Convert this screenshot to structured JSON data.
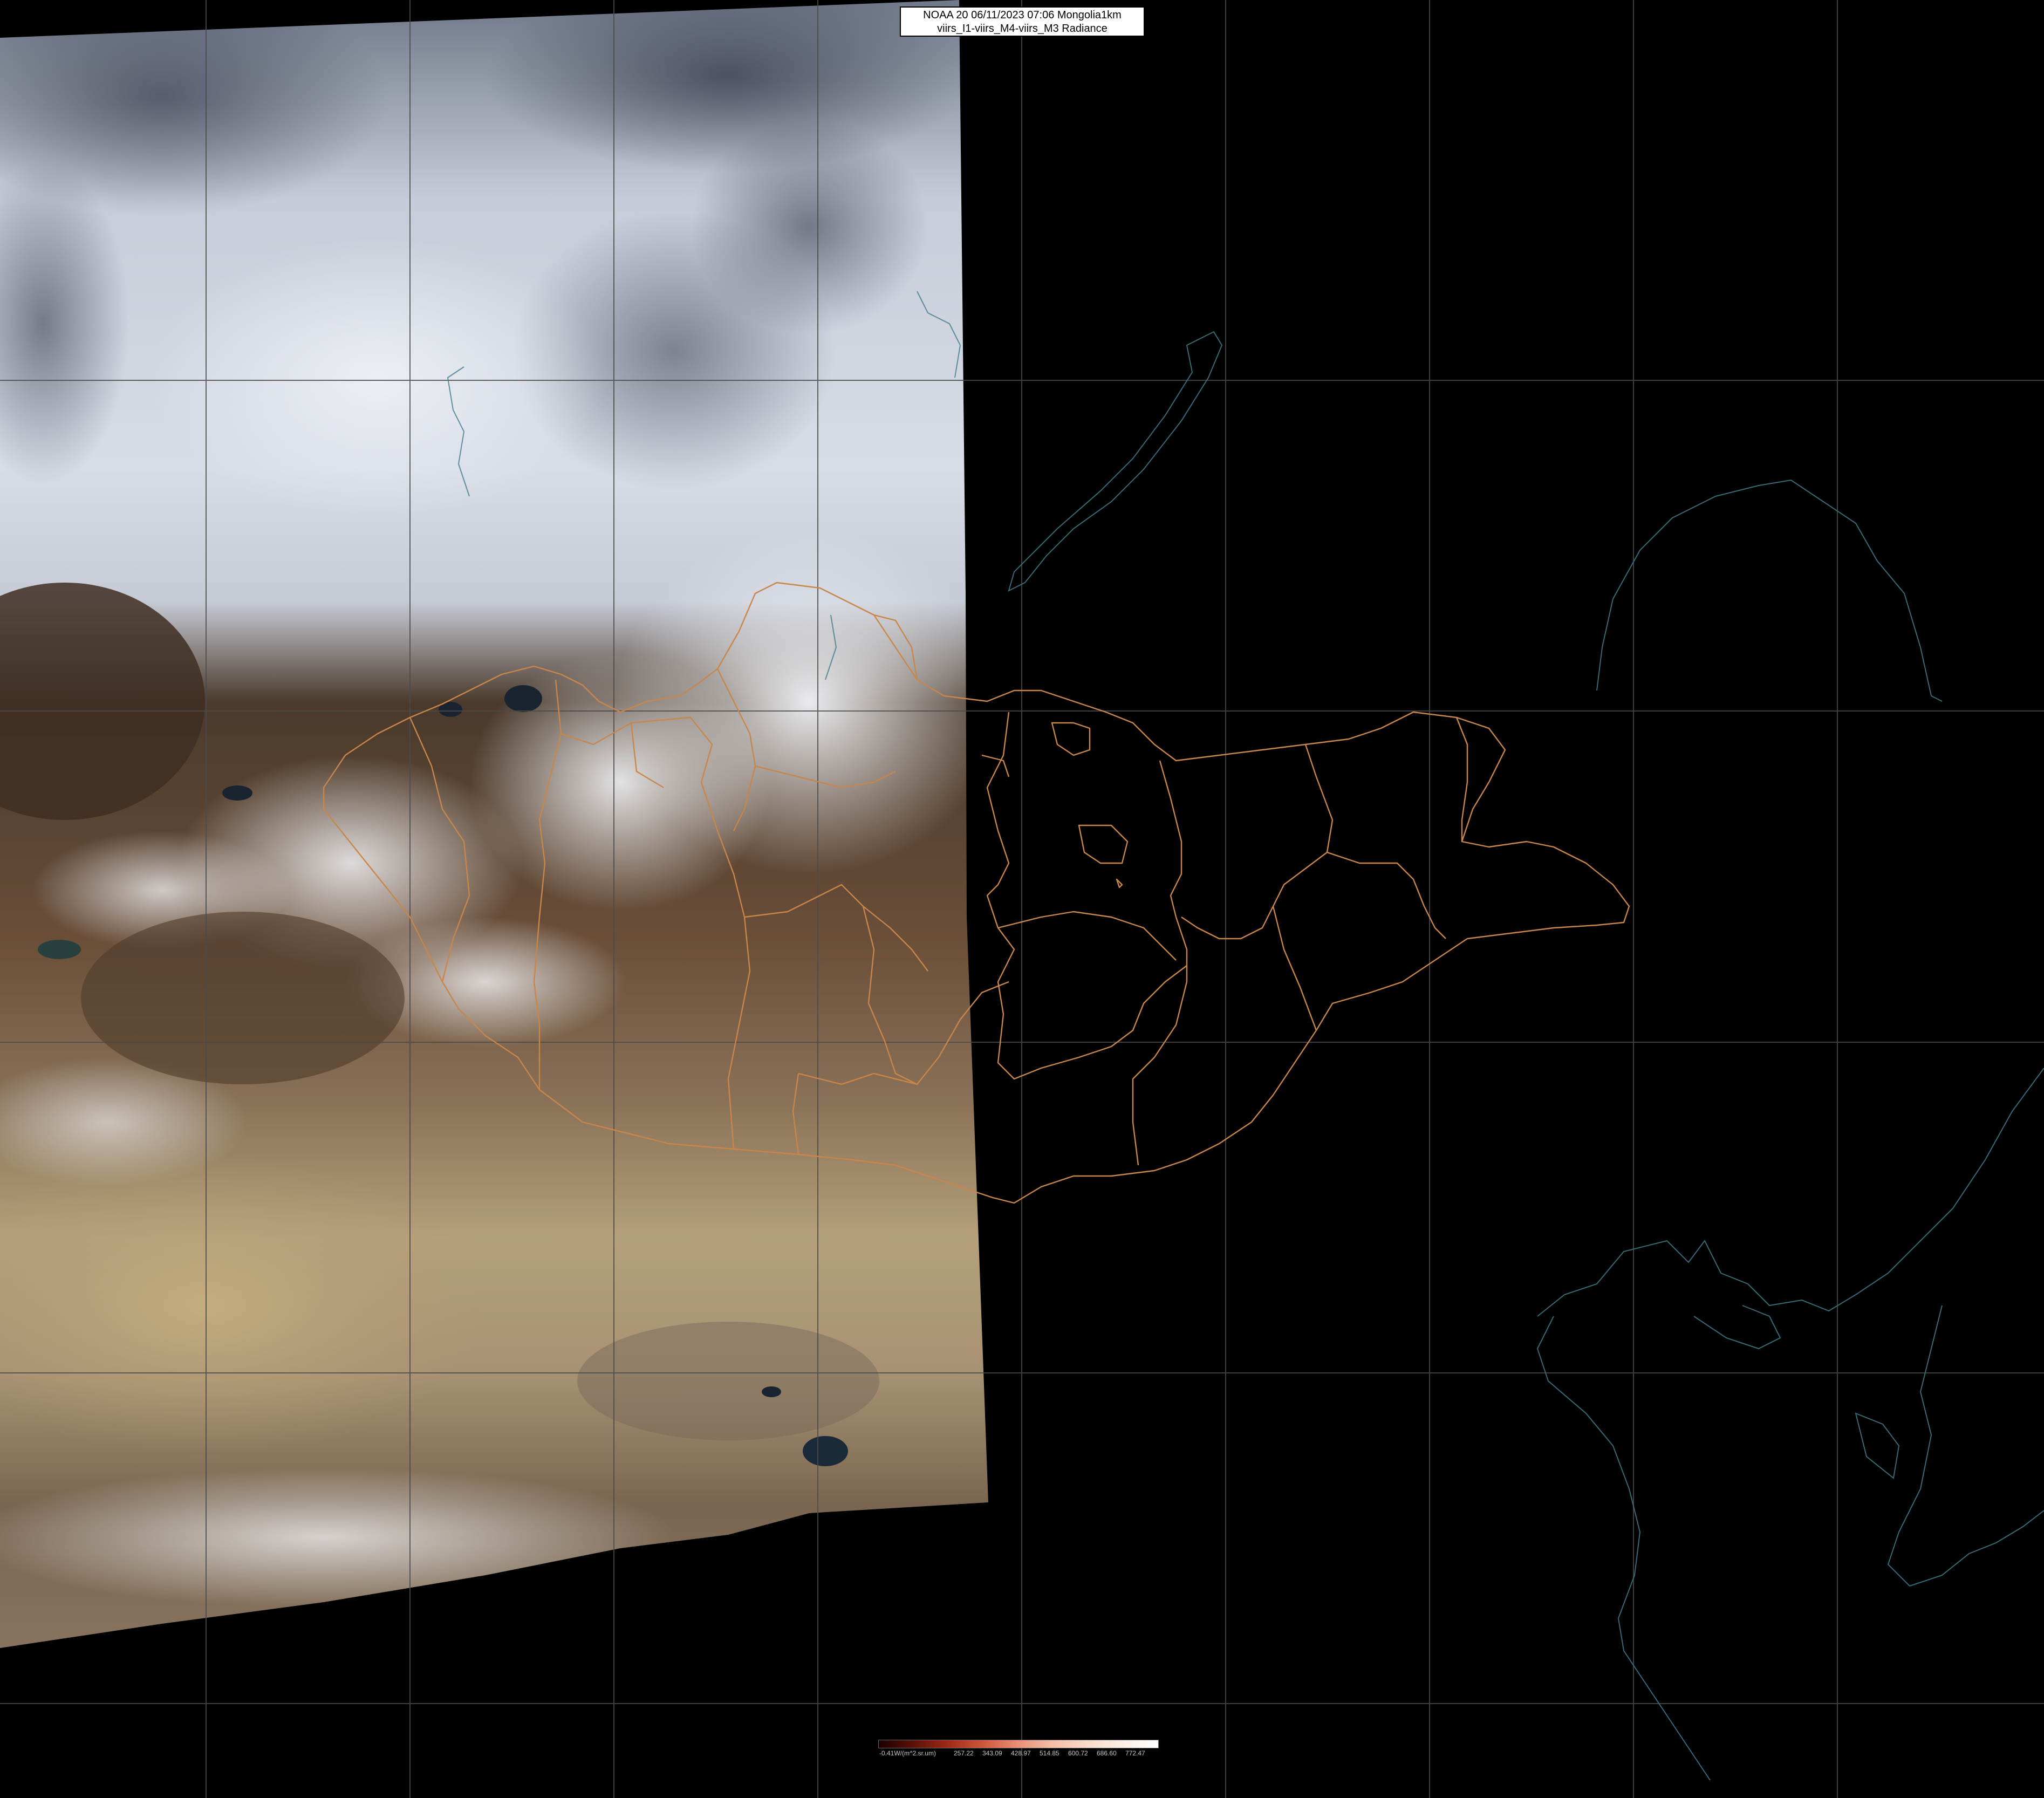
{
  "header": {
    "line1": "NOAA 20 06/11/2023 07:06 Mongolia1km",
    "line2": "viirs_I1-viirs_M4-viirs_M3 Radiance"
  },
  "colorbar": {
    "unit_label": "-0.41W/(m^2.sr.um)",
    "ticks": [
      "257.22",
      "343.09",
      "428.97",
      "514.85",
      "600.72",
      "686.60",
      "772.47"
    ]
  },
  "colors": {
    "border": "#c8864a",
    "coast": "#3a6a78",
    "grid": "#4a4a4a",
    "snow": "#e8ecf2",
    "desert": "#b8a278",
    "bare_land": "#6a4a34"
  }
}
